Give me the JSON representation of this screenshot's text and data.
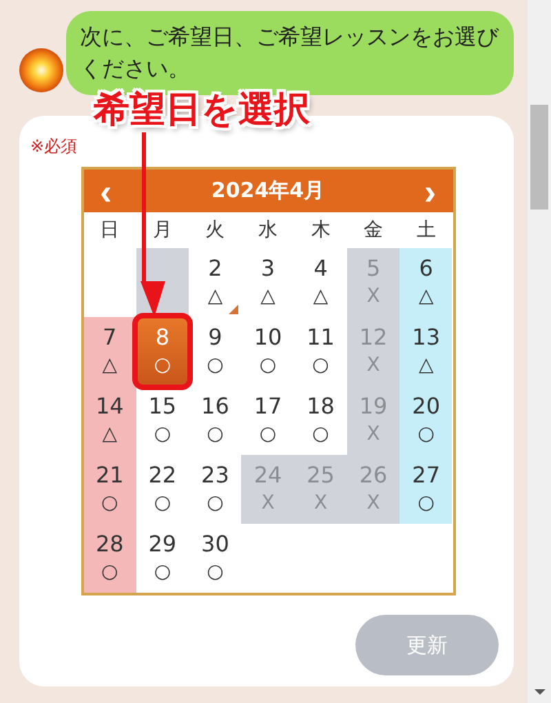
{
  "message": {
    "text": "次に、ご希望日、ご希望レッスンをお選びください。"
  },
  "annotation": {
    "label": "希望日を選択"
  },
  "form": {
    "required_note": "※必須",
    "calendar": {
      "prev": "‹",
      "title": "2024年4月",
      "next": "›",
      "weekdays": [
        "日",
        "月",
        "火",
        "水",
        "木",
        "金",
        "土"
      ],
      "weeks": [
        [
          {
            "closed": false
          },
          {
            "closed": true
          },
          {
            "day": "2",
            "mark": "△",
            "closed": false,
            "selected": false,
            "today": true
          },
          {
            "day": "3",
            "mark": "△",
            "closed": false,
            "selected": false
          },
          {
            "day": "4",
            "mark": "△",
            "closed": false,
            "selected": false
          },
          {
            "day": "5",
            "mark": "X",
            "closed": true,
            "selected": false
          },
          {
            "day": "6",
            "mark": "△",
            "closed": false,
            "selected": false
          }
        ],
        [
          {
            "day": "7",
            "mark": "△",
            "closed": false,
            "selected": false
          },
          {
            "day": "8",
            "mark": "○",
            "closed": false,
            "selected": true
          },
          {
            "day": "9",
            "mark": "○",
            "closed": false,
            "selected": false
          },
          {
            "day": "10",
            "mark": "○",
            "closed": false,
            "selected": false
          },
          {
            "day": "11",
            "mark": "○",
            "closed": false,
            "selected": false
          },
          {
            "day": "12",
            "mark": "X",
            "closed": true,
            "selected": false
          },
          {
            "day": "13",
            "mark": "△",
            "closed": false,
            "selected": false
          }
        ],
        [
          {
            "day": "14",
            "mark": "△",
            "closed": false,
            "selected": false
          },
          {
            "day": "15",
            "mark": "○",
            "closed": false,
            "selected": false
          },
          {
            "day": "16",
            "mark": "○",
            "closed": false,
            "selected": false
          },
          {
            "day": "17",
            "mark": "○",
            "closed": false,
            "selected": false
          },
          {
            "day": "18",
            "mark": "○",
            "closed": false,
            "selected": false
          },
          {
            "day": "19",
            "mark": "X",
            "closed": true,
            "selected": false
          },
          {
            "day": "20",
            "mark": "○",
            "closed": false,
            "selected": false
          }
        ],
        [
          {
            "day": "21",
            "mark": "○",
            "closed": false,
            "selected": false
          },
          {
            "day": "22",
            "mark": "○",
            "closed": false,
            "selected": false
          },
          {
            "day": "23",
            "mark": "○",
            "closed": false,
            "selected": false
          },
          {
            "day": "24",
            "mark": "X",
            "closed": true,
            "selected": false
          },
          {
            "day": "25",
            "mark": "X",
            "closed": true,
            "selected": false
          },
          {
            "day": "26",
            "mark": "X",
            "closed": true,
            "selected": false
          },
          {
            "day": "27",
            "mark": "○",
            "closed": false,
            "selected": false
          }
        ],
        [
          {
            "day": "28",
            "mark": "○",
            "closed": false,
            "selected": false
          },
          {
            "day": "29",
            "mark": "○",
            "closed": false,
            "selected": false
          },
          {
            "day": "30",
            "mark": "○",
            "closed": false,
            "selected": false
          },
          {
            "closed": false
          },
          {
            "closed": false
          },
          {
            "closed": false
          },
          {
            "closed": false
          }
        ]
      ]
    },
    "submit": {
      "label": "更新",
      "disabled": true
    }
  }
}
